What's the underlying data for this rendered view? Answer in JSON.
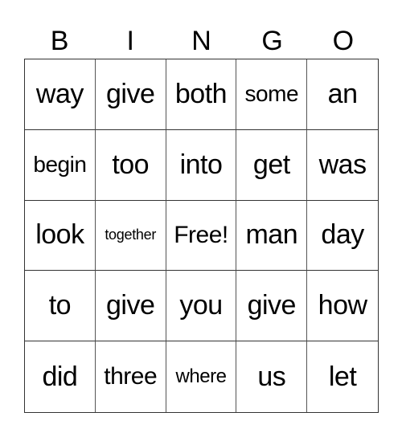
{
  "header": [
    "B",
    "I",
    "N",
    "G",
    "O"
  ],
  "rows": [
    [
      "way",
      "give",
      "both",
      "some",
      "an"
    ],
    [
      "begin",
      "too",
      "into",
      "get",
      "was"
    ],
    [
      "look",
      "together",
      "Free!",
      "man",
      "day"
    ],
    [
      "to",
      "give",
      "you",
      "give",
      "how"
    ],
    [
      "did",
      "three",
      "where",
      "us",
      "let"
    ]
  ]
}
